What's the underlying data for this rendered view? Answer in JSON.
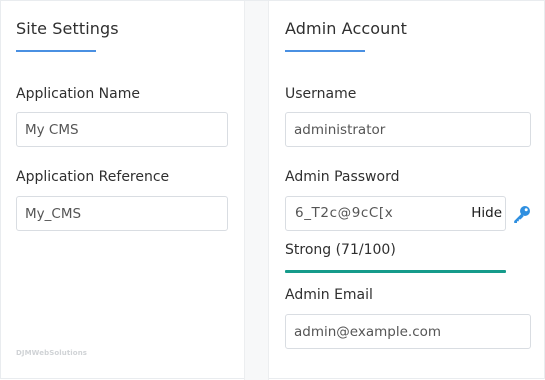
{
  "site_settings": {
    "title": "Site Settings",
    "application_name": {
      "label": "Application Name",
      "value": "My CMS"
    },
    "application_reference": {
      "label": "Application Reference",
      "value": "My_CMS"
    }
  },
  "admin_account": {
    "title": "Admin Account",
    "username": {
      "label": "Username",
      "value": "administrator"
    },
    "password": {
      "label": "Admin Password",
      "value": "6_T2c@9cC[x",
      "toggle_label": "Hide",
      "generate_icon": "key-icon",
      "strength_text": "Strong (71/100)",
      "strength_score": 71,
      "strength_color": "#159b8b"
    },
    "email": {
      "label": "Admin Email",
      "value": "admin@example.com"
    }
  },
  "watermark": "DJMWebSolutions",
  "colors": {
    "accent": "#4a90e2",
    "strength": "#159b8b",
    "input_border": "#d9dde2"
  }
}
